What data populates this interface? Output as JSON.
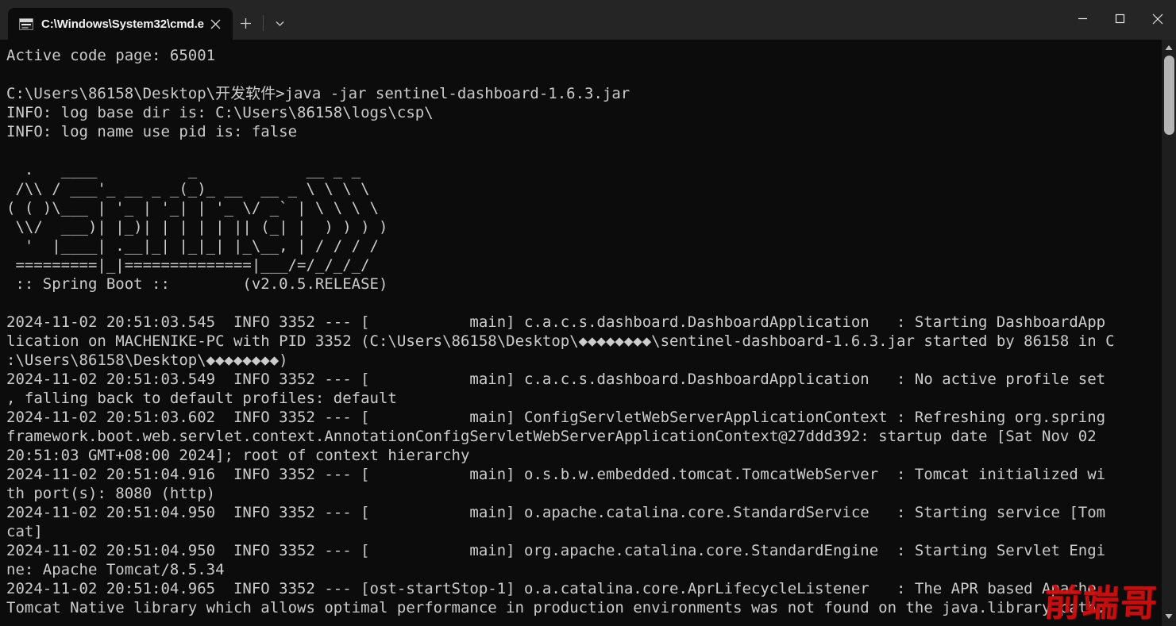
{
  "window": {
    "tab": {
      "title": "C:\\Windows\\System32\\cmd.e",
      "icon": "cmd-console-icon",
      "close_label": "✕"
    },
    "new_tab_label": "+",
    "tab_dropdown_label": "⌄",
    "controls": {
      "minimize": "–",
      "maximize": "☐",
      "close": "✕"
    }
  },
  "scrollbar": {
    "up_arrow": "▲",
    "down_arrow": "▼"
  },
  "watermark": {
    "text": "前端哥",
    "color": "#cc1111"
  },
  "terminal": {
    "background": "#0c0c0c",
    "foreground": "#cccccc",
    "lines": [
      "Active code page: 65001",
      "",
      "C:\\Users\\86158\\Desktop\\开发软件>java -jar sentinel-dashboard-1.6.3.jar",
      "INFO: log base dir is: C:\\Users\\86158\\logs\\csp\\",
      "INFO: log name use pid is: false",
      "",
      "  .   ____          _            __ _ _",
      " /\\\\ / ___'_ __ _ _(_)_ __  __ _ \\ \\ \\ \\",
      "( ( )\\___ | '_ | '_| | '_ \\/ _` | \\ \\ \\ \\",
      " \\\\/  ___)| |_)| | | | | || (_| |  ) ) ) )",
      "  '  |____| .__|_| |_|_| |_\\__, | / / / /",
      " =========|_|==============|___/=/_/_/_/",
      " :: Spring Boot ::        (v2.0.5.RELEASE)",
      "",
      "2024-11-02 20:51:03.545  INFO 3352 --- [           main] c.a.c.s.dashboard.DashboardApplication   : Starting DashboardApp",
      "lication on MACHENIKE-PC with PID 3352 (C:\\Users\\86158\\Desktop\\◆◆◆◆◆◆◆◆\\sentinel-dashboard-1.6.3.jar started by 86158 in C",
      ":\\Users\\86158\\Desktop\\◆◆◆◆◆◆◆◆)",
      "2024-11-02 20:51:03.549  INFO 3352 --- [           main] c.a.c.s.dashboard.DashboardApplication   : No active profile set",
      ", falling back to default profiles: default",
      "2024-11-02 20:51:03.602  INFO 3352 --- [           main] ConfigServletWebServerApplicationContext : Refreshing org.spring",
      "framework.boot.web.servlet.context.AnnotationConfigServletWebServerApplicationContext@27ddd392: startup date [Sat Nov 02",
      "20:51:03 GMT+08:00 2024]; root of context hierarchy",
      "2024-11-02 20:51:04.916  INFO 3352 --- [           main] o.s.b.w.embedded.tomcat.TomcatWebServer  : Tomcat initialized wi",
      "th port(s): 8080 (http)",
      "2024-11-02 20:51:04.950  INFO 3352 --- [           main] o.apache.catalina.core.StandardService   : Starting service [Tom",
      "cat]",
      "2024-11-02 20:51:04.950  INFO 3352 --- [           main] org.apache.catalina.core.StandardEngine  : Starting Servlet Engi",
      "ne: Apache Tomcat/8.5.34",
      "2024-11-02 20:51:04.965  INFO 3352 --- [ost-startStop-1] o.a.catalina.core.AprLifecycleListener   : The APR based Apache",
      "Tomcat Native library which allows optimal performance in production environments was not found on the java.library path:"
    ]
  }
}
